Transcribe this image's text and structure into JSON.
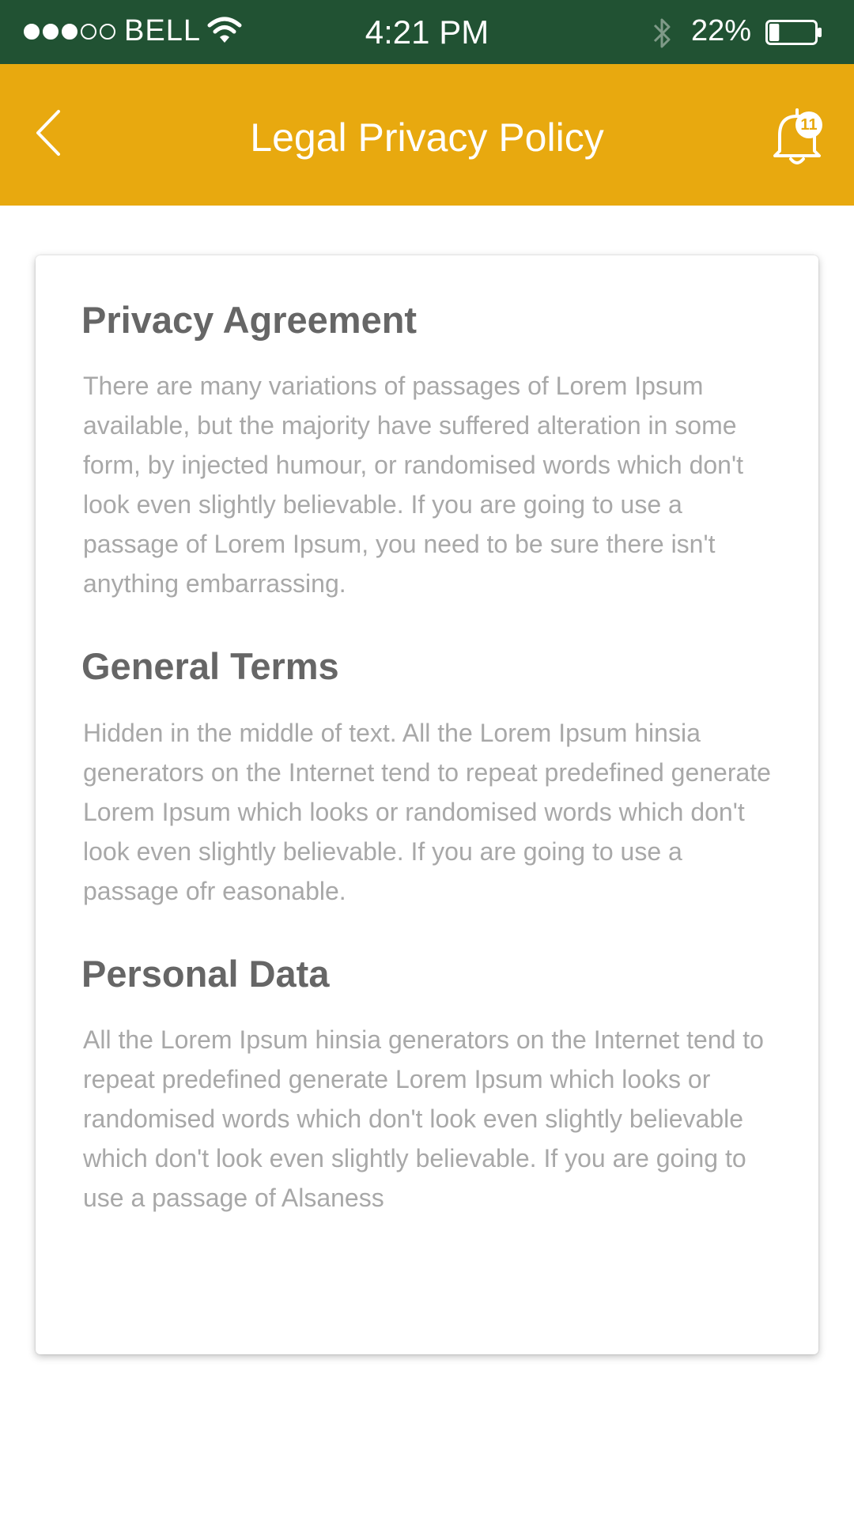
{
  "status_bar": {
    "carrier": "BELL",
    "time": "4:21 PM",
    "battery_percent": "22%",
    "battery_level": 0.22,
    "signal_bars_filled": 3,
    "signal_bars_total": 5,
    "icons": [
      "wifi-icon",
      "bluetooth-icon",
      "battery-icon"
    ]
  },
  "nav": {
    "title": "Legal Privacy Policy",
    "back_icon": "chevron-left-icon",
    "notification_icon": "bell-icon",
    "notification_count": "11"
  },
  "sections": [
    {
      "heading": "Privacy Agreement",
      "body": "There are many variations of passages of Lorem Ipsum available, but the majority have suffered alteration in some form, by injected humour, or randomised words which don't look even slightly believable. If you are going to use a passage of Lorem Ipsum, you need to be sure there isn't anything embarrassing."
    },
    {
      "heading": "General Terms",
      "body": "Hidden in the middle of text. All the Lorem Ipsum hinsia generators on the Internet tend to repeat predefined generate Lorem Ipsum which looks or randomised words which don't look even slightly believable. If you are going to use a passage ofr easonable."
    },
    {
      "heading": "Personal Data",
      "body": "All the Lorem Ipsum hinsia generators on the Internet tend to repeat predefined generate Lorem Ipsum which looks or randomised words which don't look even slightly believable which don't look even slightly believable. If you are going to use a passage of Alsaness"
    }
  ],
  "colors": {
    "status_bar": "#215233",
    "nav_bar": "#e8a90f",
    "heading": "#666666",
    "body_text": "#a8a8a8"
  }
}
